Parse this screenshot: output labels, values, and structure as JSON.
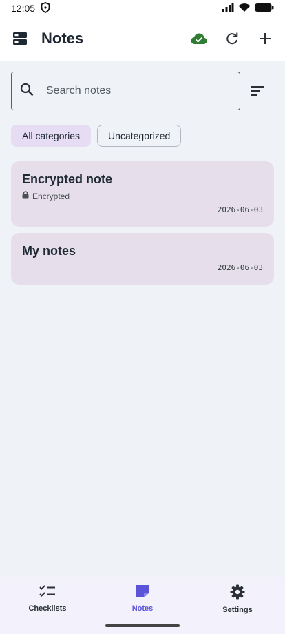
{
  "status_bar": {
    "time": "12:05"
  },
  "app_bar": {
    "title": "Notes"
  },
  "search": {
    "placeholder": "Search notes",
    "value": ""
  },
  "chips": [
    {
      "label": "All categories",
      "selected": true
    },
    {
      "label": "Uncategorized",
      "selected": false
    }
  ],
  "notes": [
    {
      "title": "Encrypted note",
      "subtitle": "Encrypted",
      "date": "2026-06-03"
    },
    {
      "title": "My notes",
      "date": "2026-06-03"
    }
  ],
  "bottom_nav": [
    {
      "label": "Checklists",
      "icon": "checklist-icon"
    },
    {
      "label": "Notes",
      "icon": "note-icon",
      "active": true
    },
    {
      "label": "Settings",
      "icon": "gear-icon"
    }
  ],
  "colors": {
    "accent": "#5b54d8",
    "sync_ok": "#2e7d32",
    "card_bg": "#e6dfeb",
    "chip_selected": "#e6dcf3"
  }
}
